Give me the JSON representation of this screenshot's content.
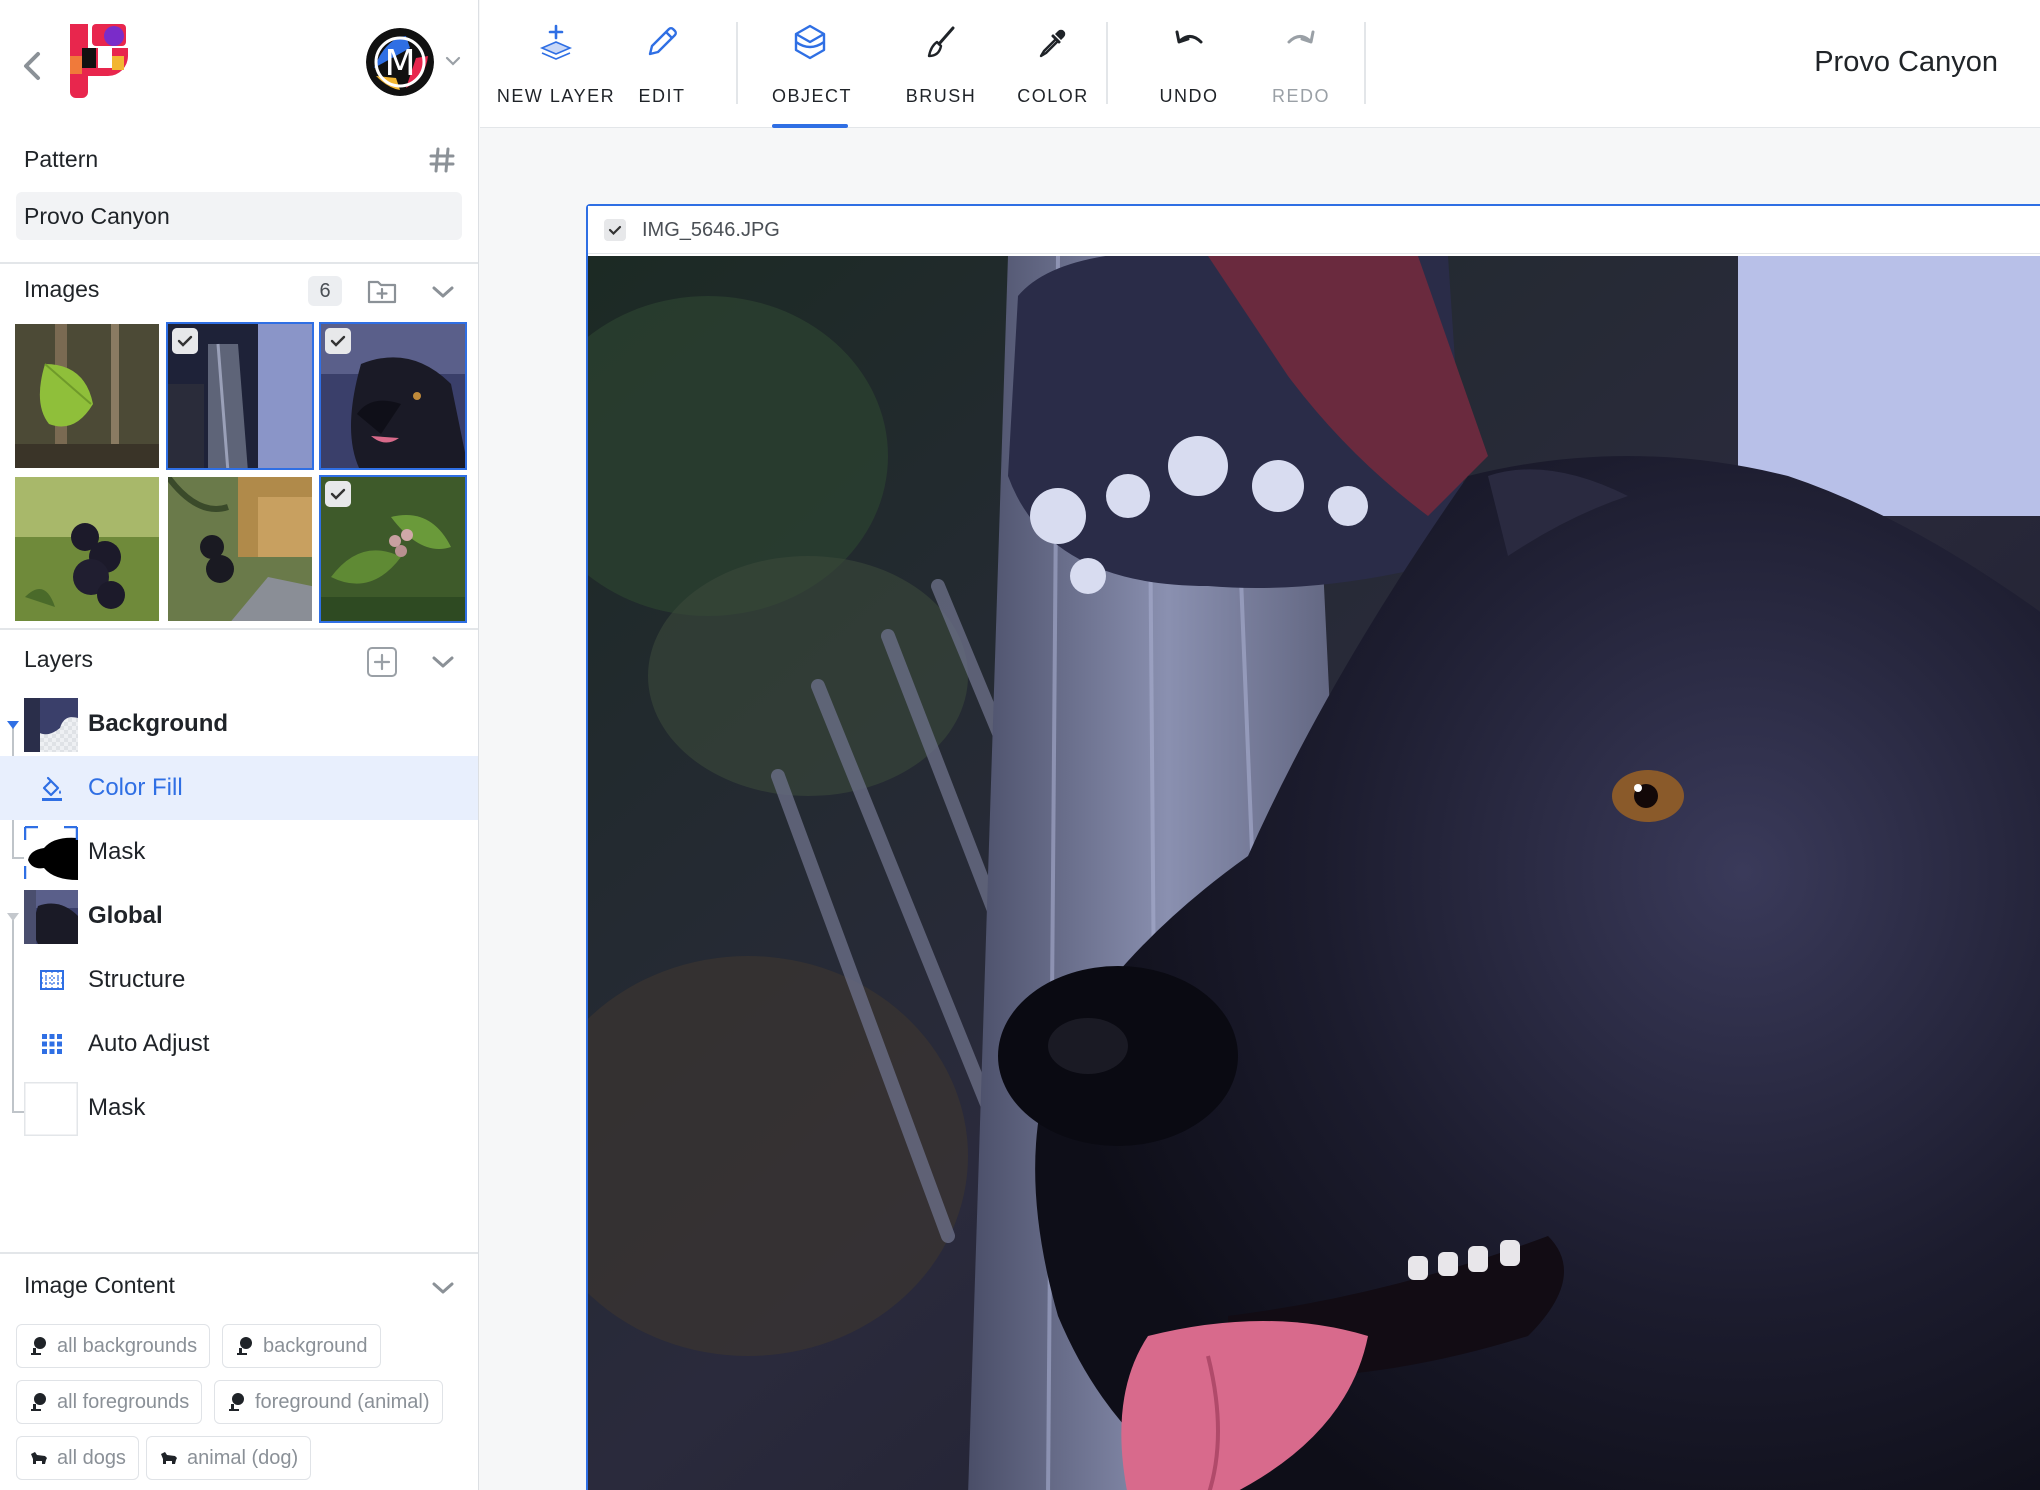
{
  "app": {
    "project_name": "Provo Canyon"
  },
  "sidebar": {
    "pattern": {
      "title": "Pattern",
      "value": "Provo Canyon"
    },
    "images": {
      "title": "Images",
      "count": "6"
    },
    "layers": {
      "title": "Layers",
      "items": [
        {
          "label": "Background",
          "weight": "bold"
        },
        {
          "label": "Color Fill",
          "active": true
        },
        {
          "label": "Mask"
        },
        {
          "label": "Global",
          "weight": "bold"
        },
        {
          "label": "Structure"
        },
        {
          "label": "Auto Adjust"
        },
        {
          "label": "Mask"
        }
      ]
    },
    "image_content": {
      "title": "Image Content",
      "tags": [
        "all backgrounds",
        "background",
        "all foregrounds",
        "foreground (animal)",
        "all dogs",
        "animal (dog)"
      ]
    }
  },
  "toolbar": {
    "tools": [
      "NEW LAYER",
      "EDIT",
      "OBJECT",
      "BRUSH",
      "COLOR",
      "UNDO",
      "REDO"
    ],
    "active_tool": "OBJECT",
    "disabled_tool": "REDO"
  },
  "canvas": {
    "filename": "IMG_5646.JPG"
  },
  "colors": {
    "accent": "#2f6fe4",
    "active_row": "#e8effd"
  }
}
